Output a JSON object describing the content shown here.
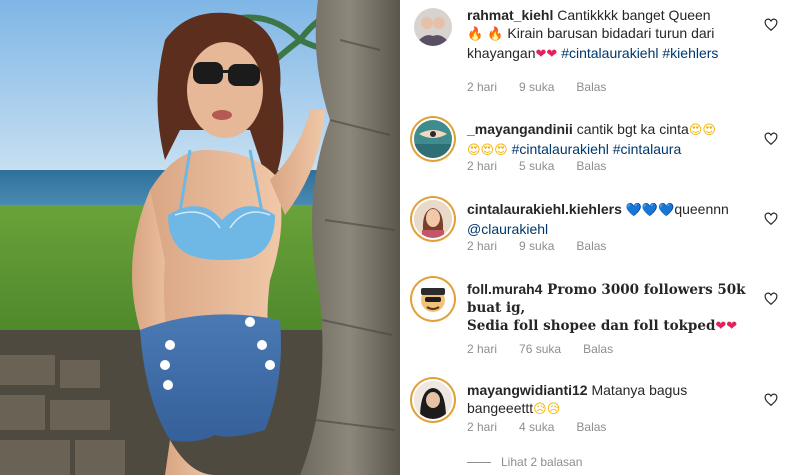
{
  "colors": {
    "link": "#00376b",
    "meta": "#8e8e8e",
    "text": "#262626",
    "heart_emoji": "#e0245e"
  },
  "comments": [
    {
      "user": "rahmat_kiehl",
      "text_a": "Cantikkkk banget Queen",
      "emoji_fire": "🔥 🔥",
      "text_b": "Kirain barusan bidadari turun dari khayangan",
      "emoji_hearts": "❤❤",
      "tag1": "#cintalaurakiehl",
      "tag2": "#kiehlers",
      "time": "2 hari",
      "likes": "9 suka",
      "reply": "Balas"
    },
    {
      "user": "_mayangandinii",
      "text_a": "cantik bgt ka cinta",
      "emoji_a": "😍😍",
      "emoji_b": "😍😍😍",
      "tag1": "#cintalaurakiehl",
      "tag2": "#cintalaura",
      "time": "2 hari",
      "likes": "5 suka",
      "reply": "Balas"
    },
    {
      "user": "cintalaurakiehl.kiehlers",
      "emoji_hearts": "💙💙💙",
      "text_a": "queennn",
      "mention": "@claurakiehl",
      "time": "2 hari",
      "likes": "9 suka",
      "reply": "Balas"
    },
    {
      "user": "foll.murah4",
      "text_a": "Promo 3000 followers 50k buat ig,",
      "text_b": "Sedia foll shopee dan foll tokped",
      "emoji_hearts": "❤❤",
      "time": "2 hari",
      "likes": "76 suka",
      "reply": "Balas"
    },
    {
      "user": "mayangwidianti12",
      "text_a": "Matanya bagus bangeeettt",
      "emoji_sad": "😥😥",
      "time": "2 hari",
      "likes": "4 suka",
      "reply": "Balas"
    }
  ],
  "view_replies": "Lihat 2 balasan"
}
